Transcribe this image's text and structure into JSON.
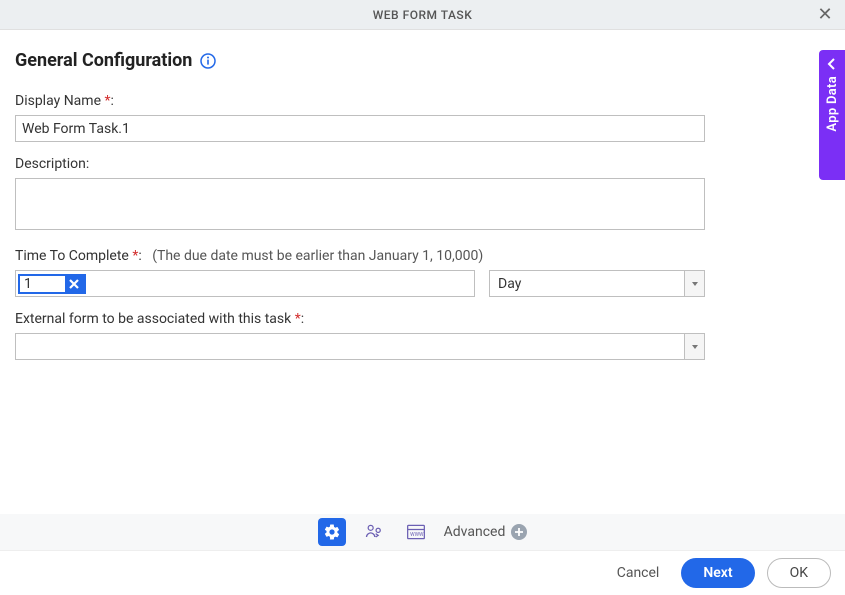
{
  "header": {
    "title": "WEB FORM TASK"
  },
  "side_tab": {
    "label": "App Data"
  },
  "section": {
    "title": "General Configuration"
  },
  "fields": {
    "display_name": {
      "label": "Display Name",
      "value": "Web Form Task.1"
    },
    "description": {
      "label": "Description:"
    },
    "ttc": {
      "label": "Time To Complete",
      "hint": "(The due date must be earlier than January 1, 10,000)",
      "value": "1",
      "unit": "Day"
    },
    "ext_form": {
      "label": "External form to be associated with this task"
    }
  },
  "bottom": {
    "advanced": "Advanced"
  },
  "footer": {
    "cancel": "Cancel",
    "next": "Next",
    "ok": "OK"
  }
}
